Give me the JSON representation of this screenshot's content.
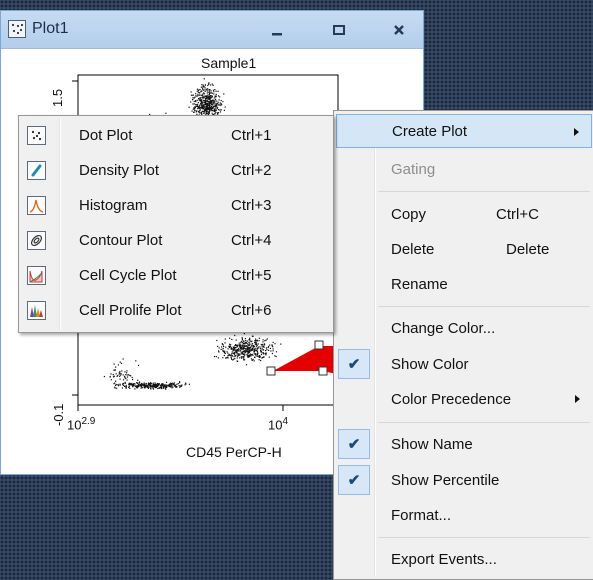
{
  "window": {
    "title": "Plot1",
    "icon": "dot-plot-icon",
    "buttons": [
      "minimize-icon",
      "maximize-icon",
      "close-icon"
    ]
  },
  "plot": {
    "title": "Sample1",
    "x_axis_label": "CD45 PerCP-H",
    "x_tick_base": "10",
    "x_tick_1_exp": "2.9",
    "x_tick_2_exp": "4",
    "y_tick_top": "1.5",
    "y_tick_bottom": "-0.1",
    "gate_color": "#ff0000"
  },
  "context_menu": {
    "items": [
      {
        "label": "Create Plot",
        "submenu": true,
        "highlighted": true
      },
      {
        "label": "Gating",
        "disabled": true
      },
      {
        "label": "Copy",
        "shortcut": "Ctrl+C"
      },
      {
        "label": "Delete",
        "shortcut": "Delete"
      },
      {
        "label": "Rename"
      },
      {
        "label": "Change Color..."
      },
      {
        "label": "Show Color",
        "checked": true
      },
      {
        "label": "Color Precedence",
        "submenu": true
      },
      {
        "label": "Show Name",
        "checked": true
      },
      {
        "label": "Show Percentile",
        "checked": true
      },
      {
        "label": "Format..."
      },
      {
        "label": "Export Events..."
      }
    ]
  },
  "submenu": {
    "items": [
      {
        "label": "Dot Plot",
        "shortcut": "Ctrl+1",
        "icon": "dot-plot-icon"
      },
      {
        "label": "Density Plot",
        "shortcut": "Ctrl+2",
        "icon": "density-plot-icon"
      },
      {
        "label": "Histogram",
        "shortcut": "Ctrl+3",
        "icon": "histogram-icon"
      },
      {
        "label": "Contour Plot",
        "shortcut": "Ctrl+4",
        "icon": "contour-plot-icon"
      },
      {
        "label": "Cell Cycle Plot",
        "shortcut": "Ctrl+5",
        "icon": "cell-cycle-plot-icon"
      },
      {
        "label": "Cell Prolife Plot",
        "shortcut": "Ctrl+6",
        "icon": "cell-prolife-plot-icon"
      }
    ]
  }
}
